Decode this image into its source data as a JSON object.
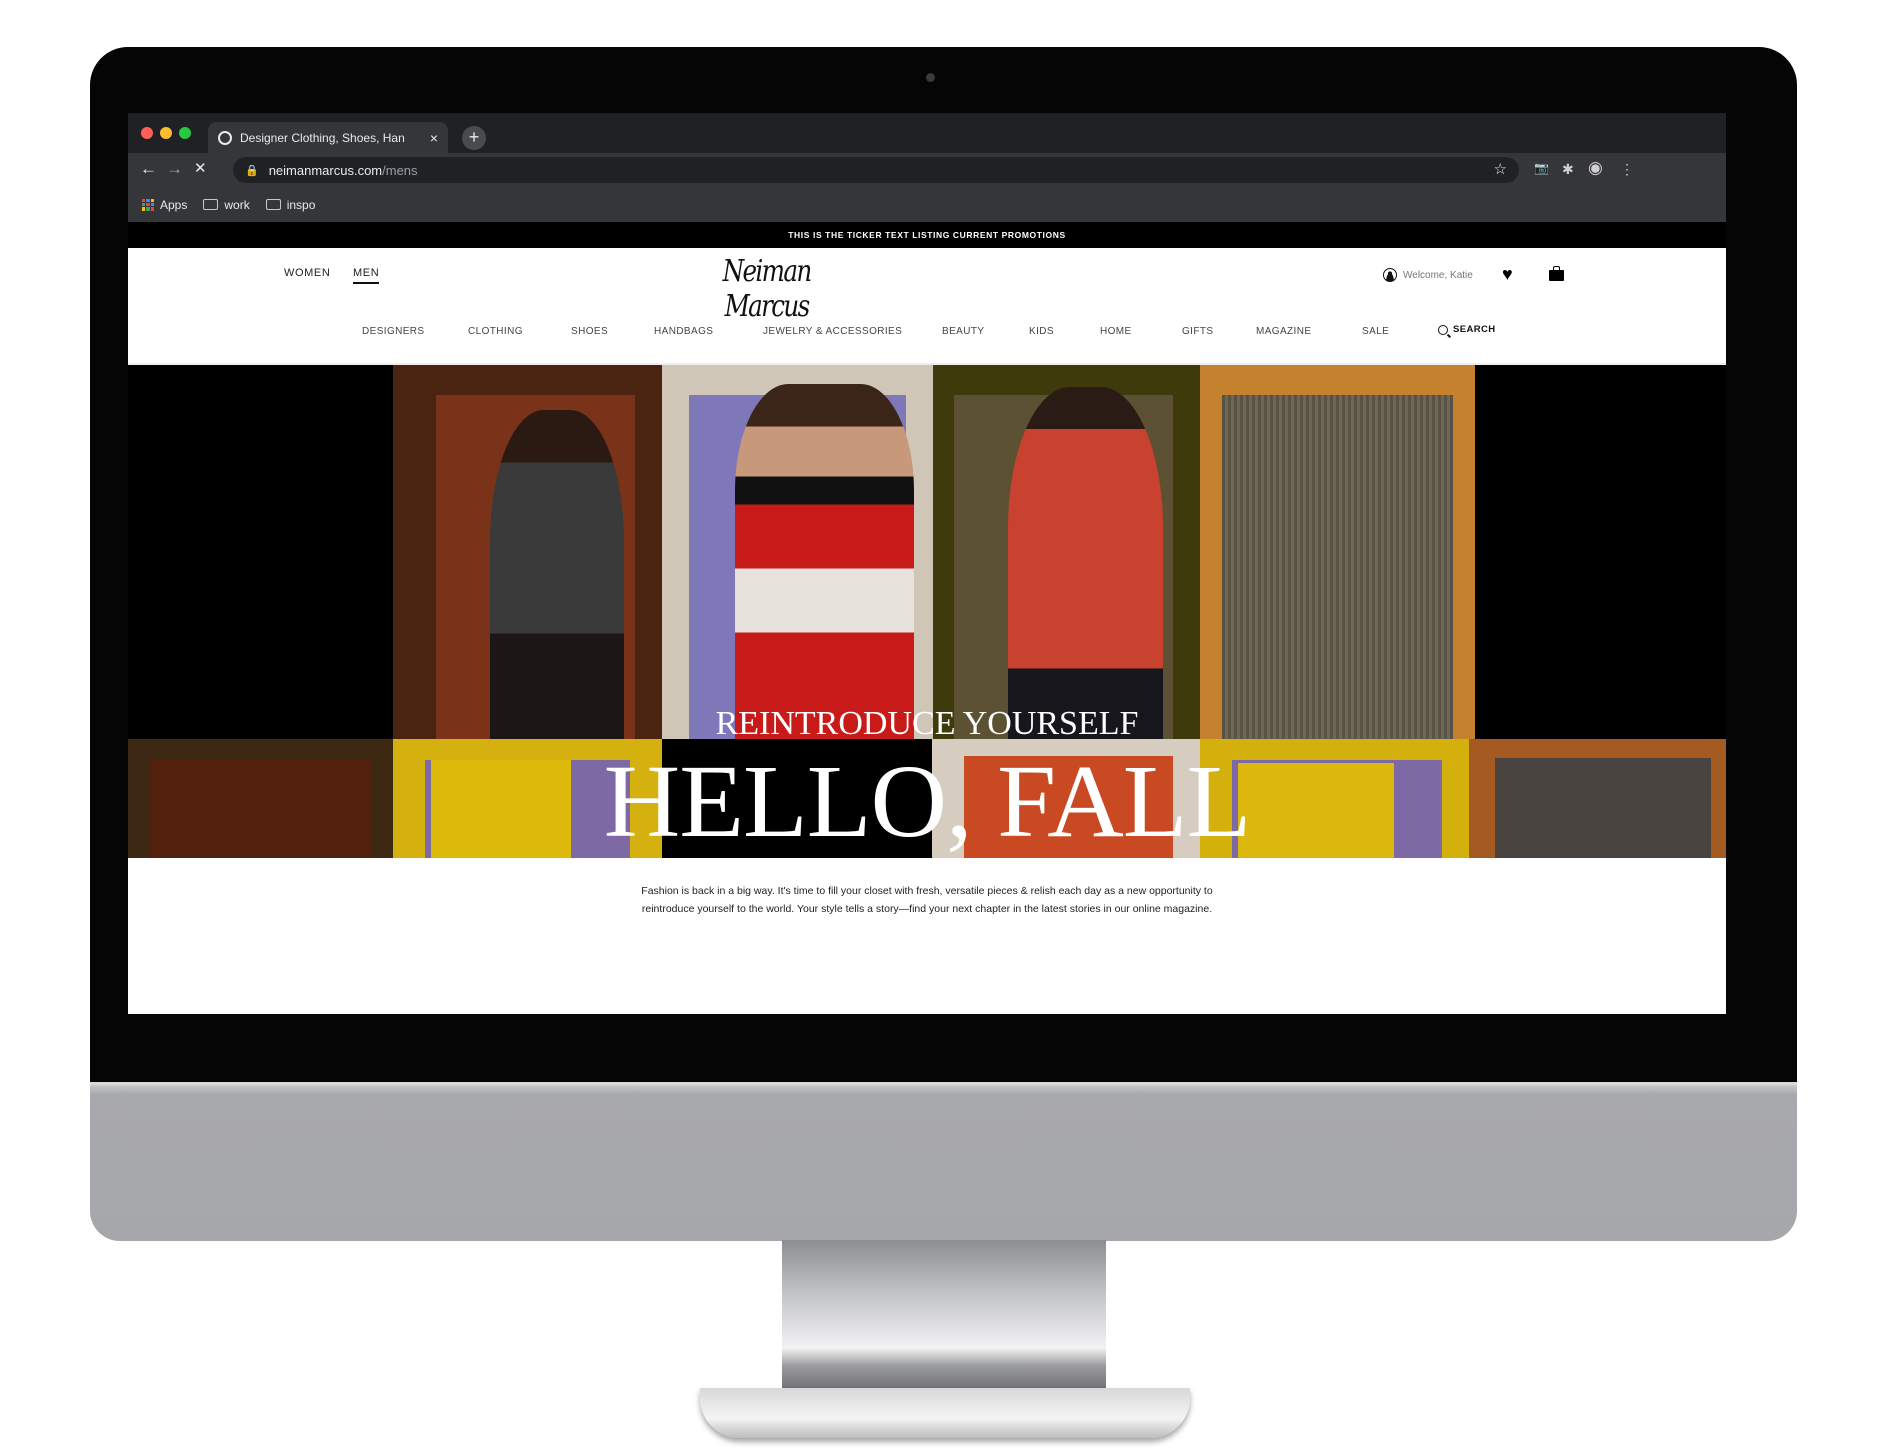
{
  "browser": {
    "tab_title": "Designer Clothing, Shoes, Han",
    "url_host": "neimanmarcus.com",
    "url_path": "/mens",
    "new_tab_label": "+",
    "close_tab_label": "×",
    "nav": {
      "back": "←",
      "forward": "→",
      "stop": "✕"
    },
    "icons": {
      "lock": "🔒",
      "star": "☆",
      "camera": "📷",
      "extensions": "✱",
      "profile": "◉",
      "menu": "⋮"
    },
    "traffic_lights": {
      "close": "#ff5f57",
      "minimize": "#febc2e",
      "maximize": "#28c840"
    },
    "bookmarks": [
      {
        "label": "Apps",
        "icon": "apps-grid-icon"
      },
      {
        "label": "work",
        "icon": "folder-icon"
      },
      {
        "label": "inspo",
        "icon": "folder-icon"
      }
    ]
  },
  "site": {
    "ticker": "THIS IS THE TICKER TEXT LISTING CURRENT PROMOTIONS",
    "logo": "Neiman Marcus",
    "gender_tabs": [
      {
        "label": "WOMEN",
        "active": false
      },
      {
        "label": "MEN",
        "active": true
      }
    ],
    "welcome": "Welcome, Katie",
    "categories": [
      "DESIGNERS",
      "CLOTHING",
      "SHOES",
      "HANDBAGS",
      "JEWELRY & ACCESSORIES",
      "BEAUTY",
      "KIDS",
      "HOME",
      "GIFTS",
      "MAGAZINE",
      "SALE"
    ],
    "search_label": "SEARCH",
    "hero": {
      "kicker": "REINTRODUCE YOURSELF",
      "headline": "HELLO, FALL",
      "top_row_colors": [
        "#000000",
        "#5a2a12",
        "#d9cfc2",
        "#4a4310",
        "#c4822f",
        "#000000"
      ],
      "bottom_row_colors": [
        "#4a2d16",
        "#d9b40d",
        "#000000",
        "#ddd3c6",
        "#d6b40c",
        "#a85e22"
      ]
    },
    "intro": [
      "Fashion is back in a big way. It's time to fill your closet with fresh, versatile pieces & relish each day as a new opportunity to",
      "reintroduce yourself to the world. Your style tells a story—find your next chapter in the latest stories in our online magazine."
    ]
  }
}
